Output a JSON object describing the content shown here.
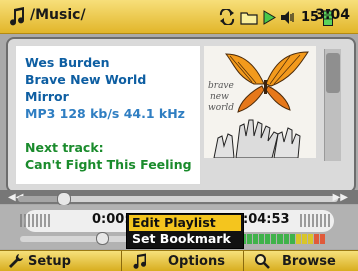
{
  "header": {
    "path": "/Music/",
    "battery_level": "15",
    "time": "3:04"
  },
  "track": {
    "artist": "Wes Burden",
    "album": "Brave New World",
    "title": "Mirror",
    "format": "MP3 128 kb/s 44.1 kHz",
    "next_label": "Next track:",
    "next_title": "Can't Fight This Feeling",
    "cover_text_line1": "brave",
    "cover_text_line2": "new",
    "cover_text_line3": "world"
  },
  "progress": {
    "elapsed": "0:00:",
    "total": ":04:53",
    "fraction": 0.14
  },
  "volume": {
    "fraction": 0.39
  },
  "menu": {
    "items": [
      {
        "label": "Edit Playlist"
      },
      {
        "label": "Set Bookmark"
      }
    ],
    "selected_index": 1
  },
  "bottom": {
    "tabs": [
      {
        "label": "Setup",
        "icon": "wrench-icon"
      },
      {
        "label": "Options",
        "icon": "music-note-icon"
      },
      {
        "label": "Browse",
        "icon": "magnifier-icon"
      }
    ]
  },
  "colors": {
    "accent": "#f4c51e",
    "text_blue": "#0d5ea2",
    "text_green": "#1a8b2c"
  }
}
